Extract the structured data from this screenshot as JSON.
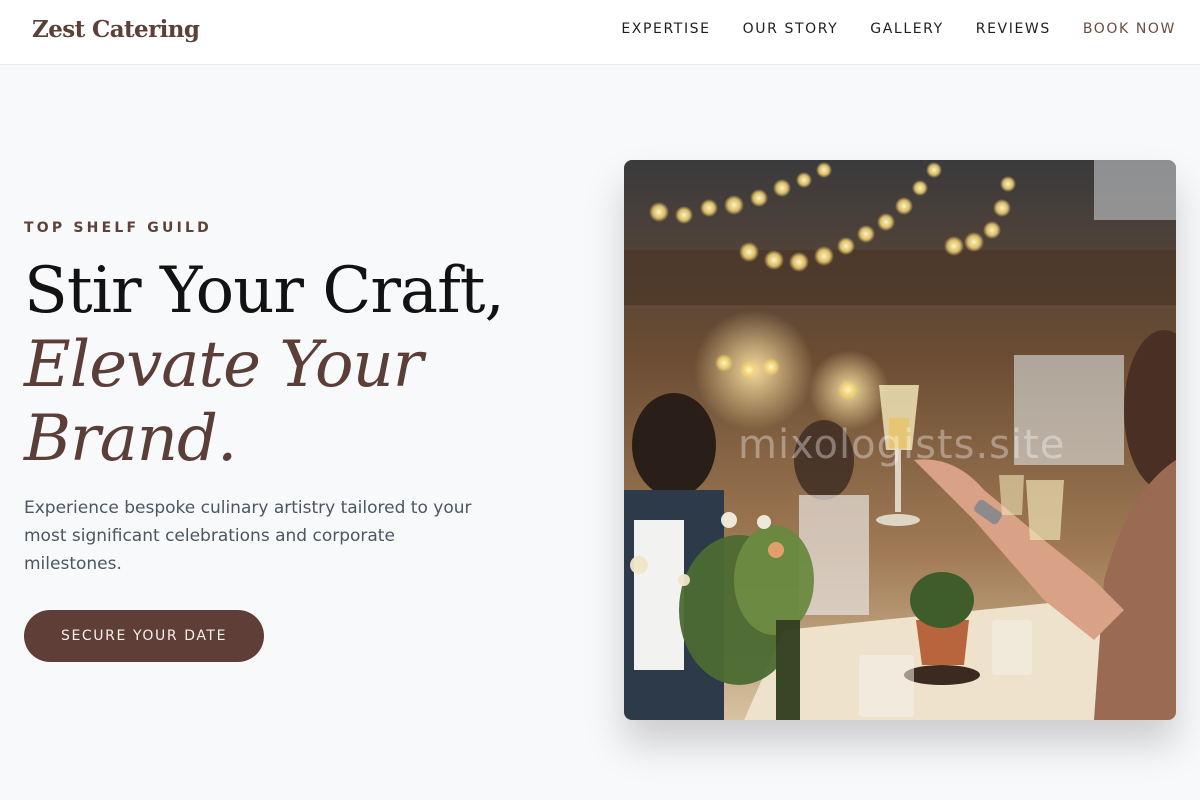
{
  "header": {
    "logo": "Zest Catering",
    "nav": [
      {
        "label": "EXPERTISE"
      },
      {
        "label": "OUR STORY"
      },
      {
        "label": "GALLERY"
      },
      {
        "label": "REVIEWS"
      },
      {
        "label": "BOOK NOW"
      }
    ]
  },
  "hero": {
    "eyebrow": "TOP SHELF GUILD",
    "headline_line1": "Stir Your Craft,",
    "headline_line2": "Elevate Your",
    "headline_line3": "Brand.",
    "description": "Experience bespoke culinary artistry tailored to your most significant celebrations and corporate milestones.",
    "cta_label": "SECURE YOUR DATE"
  },
  "photo": {
    "watermark": "mixologists.site"
  },
  "colors": {
    "brand": "#5e3e36",
    "accent_text": "#5a3e37",
    "background": "#f8f9fb"
  }
}
